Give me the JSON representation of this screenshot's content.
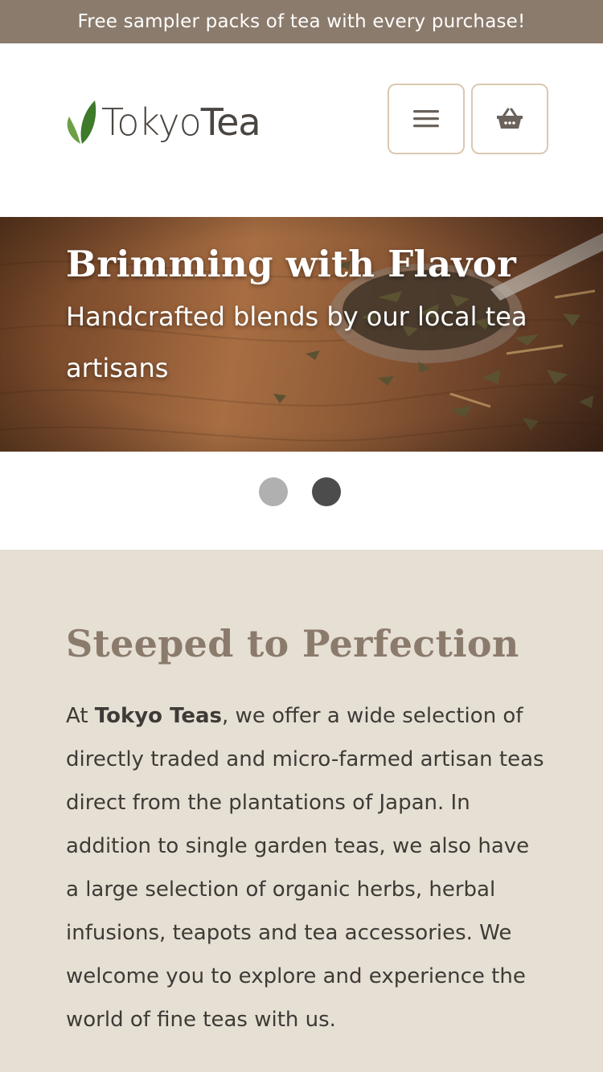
{
  "promo": {
    "text": "Free sampler packs of tea with every purchase!"
  },
  "header": {
    "logo_text_part1": "Tokyo",
    "logo_text_part2": "Tea",
    "menu_icon": "hamburger-menu-icon",
    "cart_icon": "basket-icon"
  },
  "hero": {
    "title": "Brimming with Flavor",
    "subtitle": "Handcrafted blends by our local tea artisans"
  },
  "carousel": {
    "slide_count": 2,
    "active_index": 1
  },
  "about": {
    "title": "Steeped to Perfection",
    "body_prefix": "At ",
    "body_brand": "Tokyo Teas",
    "body_rest": ", we offer a wide selection of directly traded and micro-farmed artisan teas direct from the plantations of Japan. In addition to single garden teas, we also have a large selection of organic herbs, herbal infusions, teapots and tea accessories. We welcome you to explore and experience the world of fine teas with us."
  },
  "colors": {
    "promo_bar": "#8b7b6c",
    "button_border": "#d9c9b2",
    "about_bg": "#e6dfd4",
    "heading_brown": "#8b7b6c",
    "leaf_green": "#6ca046"
  }
}
